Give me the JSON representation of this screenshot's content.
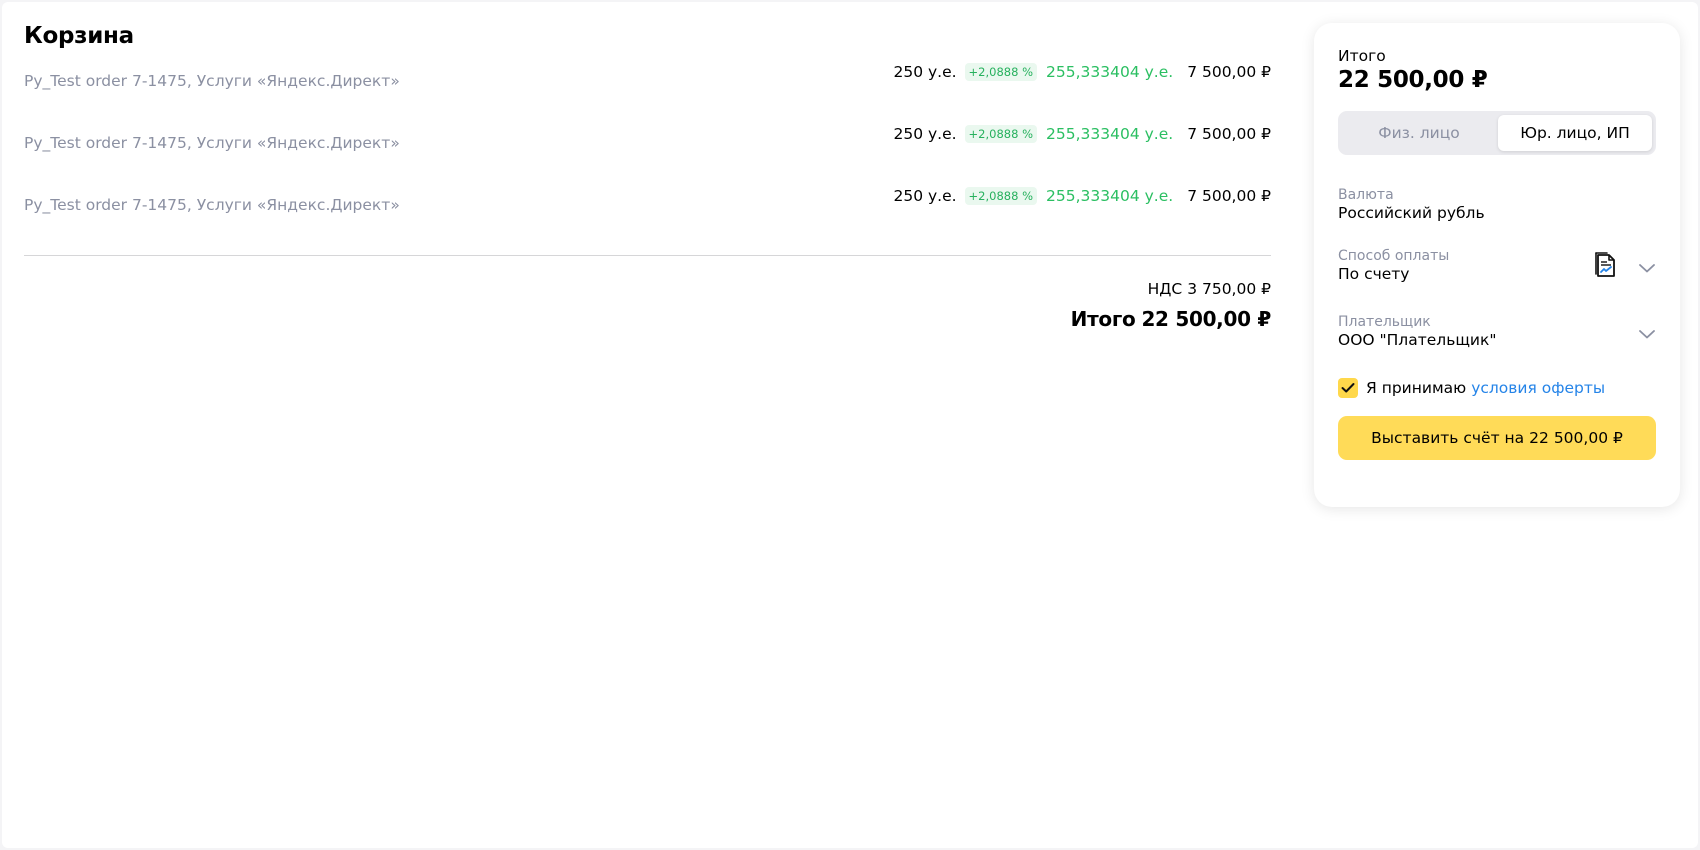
{
  "cart": {
    "title": "Корзина",
    "items": [
      {
        "name": "Py_Test order 7-1475, Услуги «Яндекс.Директ»",
        "qty": "250 у.е.",
        "bonus": "+2,0888 %",
        "qty_with_bonus": "255,333404 у.е.",
        "price": "7 500,00 ₽"
      },
      {
        "name": "Py_Test order 7-1475, Услуги «Яндекс.Директ»",
        "qty": "250 у.е.",
        "bonus": "+2,0888 %",
        "qty_with_bonus": "255,333404 у.е.",
        "price": "7 500,00 ₽"
      },
      {
        "name": "Py_Test order 7-1475, Услуги «Яндекс.Директ»",
        "qty": "250 у.е.",
        "bonus": "+2,0888 %",
        "qty_with_bonus": "255,333404 у.е.",
        "price": "7 500,00 ₽"
      }
    ],
    "vat_label": "НДС",
    "vat_value": "3 750,00 ₽",
    "total_label": "Итого",
    "total_value": "22 500,00 ₽"
  },
  "panel": {
    "sum_label": "Итого",
    "sum_value": "22 500,00 ₽",
    "payer_type": {
      "options": [
        "Физ. лицо",
        "Юр. лицо, ИП"
      ],
      "selected": "Юр. лицо, ИП"
    },
    "currency": {
      "label": "Валюта",
      "value": "Российский рубль"
    },
    "payment_method": {
      "label": "Способ оплаты",
      "value": "По счету",
      "icon": "invoice-document-icon"
    },
    "payer": {
      "label": "Плательщик",
      "value": "ООО \"Плательщик\""
    },
    "accept": {
      "checked": true,
      "text": "Я принимаю",
      "link": "условия оферты"
    },
    "submit": {
      "label": "Выставить счёт на",
      "amount": "22 500,00 ₽"
    }
  },
  "colors": {
    "accent_yellow": "#ffdb58",
    "bonus_green": "#2bbf62",
    "link_blue": "#2584e8",
    "muted": "#8b90a2"
  }
}
